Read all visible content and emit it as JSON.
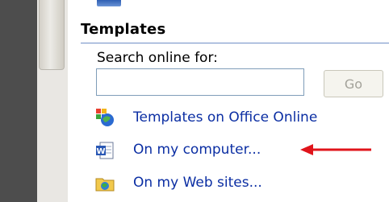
{
  "templates": {
    "title": "Templates",
    "search_label": "Search online for:",
    "search_value": "",
    "go_label": "Go",
    "links": [
      {
        "label": "Templates on Office Online",
        "icon": "office-online-icon"
      },
      {
        "label": "On my computer...",
        "icon": "word-document-icon"
      },
      {
        "label": "On my Web sites...",
        "icon": "web-folder-icon"
      }
    ]
  },
  "colors": {
    "link": "#0b2ea3",
    "accent_arrow": "#e0141b",
    "rule": "#6f8fc6"
  }
}
